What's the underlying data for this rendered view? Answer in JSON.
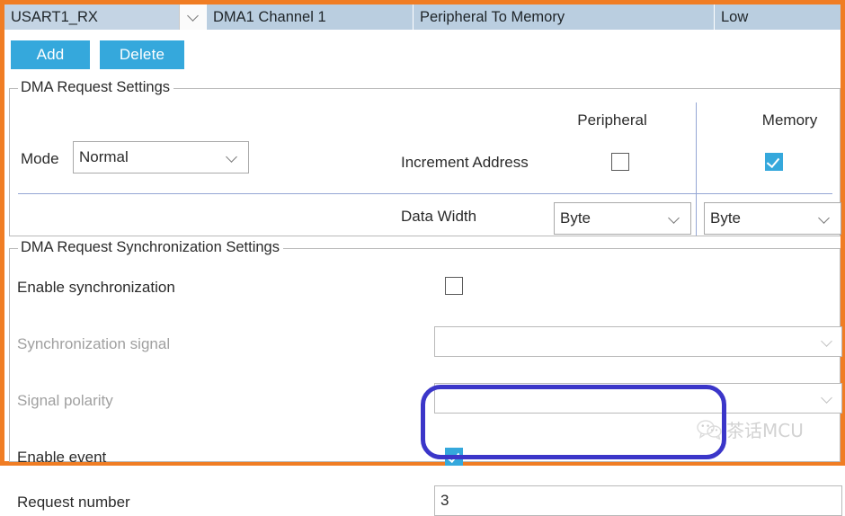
{
  "header": {
    "request_select": {
      "value": "USART1_RX",
      "arrow_icon": "chevron-down-icon"
    },
    "columns": [
      {
        "key": "channel",
        "value": "DMA1 Channel 1"
      },
      {
        "key": "direction",
        "value": "Peripheral To Memory"
      },
      {
        "key": "priority",
        "value": "Low"
      }
    ]
  },
  "toolbar": {
    "add_label": "Add",
    "delete_label": "Delete"
  },
  "request_settings": {
    "title": "DMA Request Settings",
    "column_headers": {
      "peripheral": "Peripheral",
      "memory": "Memory"
    },
    "mode": {
      "label": "Mode",
      "value": "Normal",
      "arrow_icon": "chevron-down-icon"
    },
    "increment_address": {
      "label": "Increment Address",
      "peripheral_checked": false,
      "memory_checked": true
    },
    "data_width": {
      "label": "Data Width",
      "peripheral_value": "Byte",
      "memory_value": "Byte",
      "arrow_icon": "chevron-down-icon"
    }
  },
  "sync_settings": {
    "title": "DMA Request Synchronization Settings",
    "enable_synchronization": {
      "label": "Enable synchronization",
      "checked": false
    },
    "synchronization_signal": {
      "label": "Synchronization signal",
      "value": "",
      "disabled": true,
      "arrow_icon": "chevron-down-icon"
    },
    "signal_polarity": {
      "label": "Signal polarity",
      "value": "",
      "disabled": true,
      "arrow_icon": "chevron-down-icon"
    },
    "enable_event": {
      "label": "Enable event",
      "checked": true
    },
    "request_number": {
      "label": "Request number",
      "value": "3",
      "placeholder": ""
    }
  },
  "watermark": {
    "text": "茶话MCU",
    "icon": "wechat-icon"
  },
  "colors": {
    "frame_orange": "#f07d24",
    "accent_blue": "#35a8dc",
    "header_cell": "#bacee0",
    "highlight": "#3b36c9"
  }
}
